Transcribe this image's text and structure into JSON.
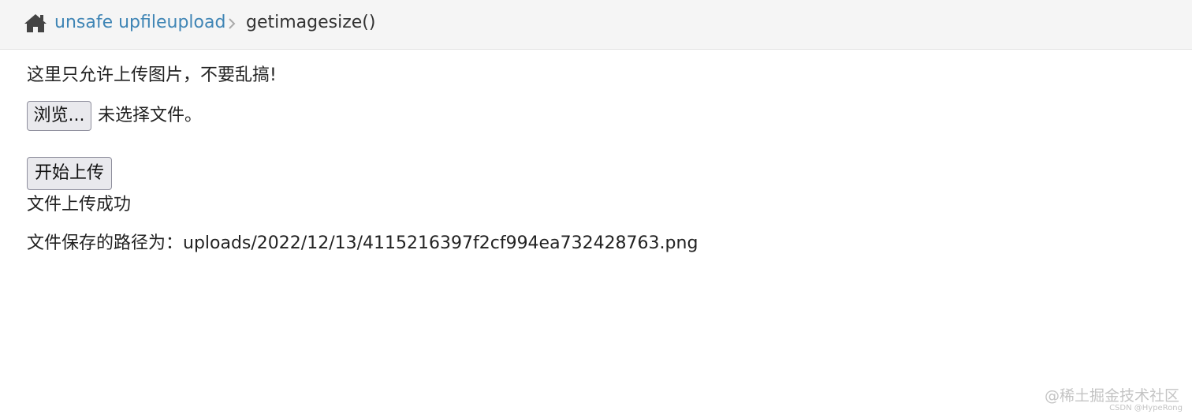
{
  "breadcrumb": {
    "home_icon": "home-icon",
    "link_label": "unsafe upfileupload",
    "separator_icon": "chevron-right-icon",
    "current_label": "getimagesize()"
  },
  "main": {
    "notice": "这里只允许上传图片，不要乱搞!",
    "browse_label": "浏览...",
    "file_status": "未选择文件。",
    "upload_label": "开始上传",
    "success_message": "文件上传成功",
    "saved_path": "文件保存的路径为：uploads/2022/12/13/4115216397f2cf994ea732428763.png"
  },
  "watermark": {
    "main": "@稀土掘金技术社区",
    "sub": "CSDN @HypeRong"
  },
  "colors": {
    "link": "#3f85b5",
    "breadcrumb_bg": "#f5f5f5",
    "text": "#222222"
  }
}
